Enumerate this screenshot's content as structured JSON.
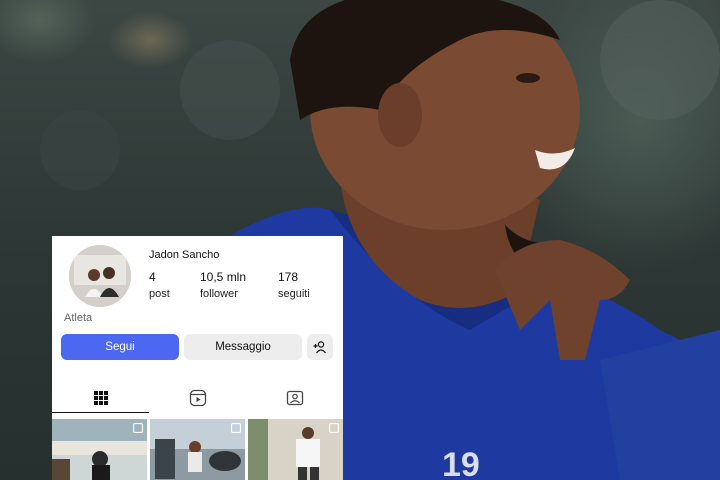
{
  "profile": {
    "username": "Jadon Sancho",
    "bio": "Atleta",
    "stats": {
      "posts": {
        "value": "4",
        "label": "post"
      },
      "followers": {
        "value": "10,5 mln",
        "label": "follower"
      },
      "following": {
        "value": "178",
        "label": "seguiti"
      }
    }
  },
  "actions": {
    "follow_label": "Segui",
    "message_label": "Messaggio"
  },
  "tabs": [
    {
      "icon": "grid-icon",
      "active": true
    },
    {
      "icon": "reels-icon",
      "active": false
    },
    {
      "icon": "tagged-icon",
      "active": false
    }
  ],
  "background": {
    "jersey_number": "19"
  },
  "colors": {
    "follow_button": "#4c68f0",
    "secondary_button": "#ededed",
    "jersey": "#1e3aa0"
  }
}
